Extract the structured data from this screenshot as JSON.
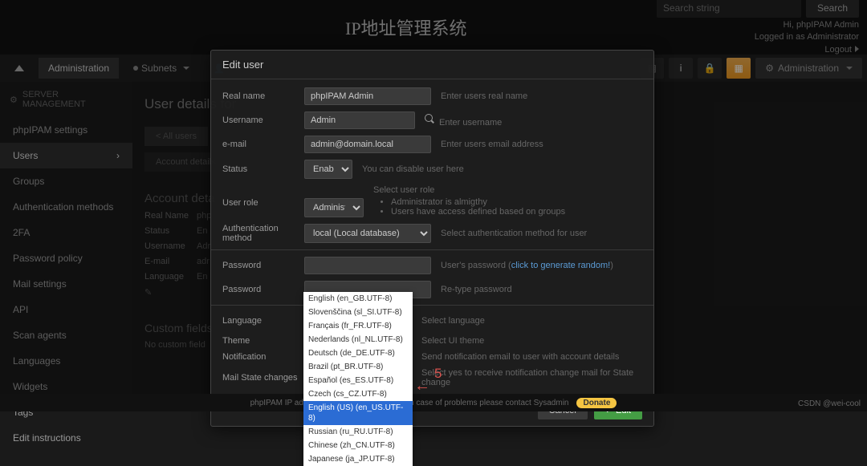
{
  "header": {
    "app_title": "IP地址管理系统",
    "search_placeholder": "Search string",
    "search_btn": "Search",
    "greeting": "Hi, phpIPAM Admin",
    "login_status": "Logged in as Administrator",
    "logout": "Logout"
  },
  "nav": {
    "administration": "Administration",
    "subnets": "Subnets",
    "admin_right": "Administration"
  },
  "sidebar": {
    "head": "SERVER MANAGEMENT",
    "items": [
      "phpIPAM settings",
      "Users",
      "Groups",
      "Authentication methods",
      "2FA",
      "Password policy",
      "Mail settings",
      "API",
      "Scan agents",
      "Languages",
      "Widgets",
      "Tags",
      "Edit instructions"
    ]
  },
  "page": {
    "title": "User details for",
    "back": "< All users",
    "tab": "Account details",
    "section": "Account deta",
    "rows": {
      "real_name_l": "Real Name",
      "real_name_v": "php",
      "status_l": "Status",
      "status_v": "En",
      "username_l": "Username",
      "username_v": "Adr",
      "email_l": "E-mail",
      "email_v": "adr",
      "language_l": "Language",
      "language_v": "En"
    },
    "custom_h": "Custom fields",
    "no_custom": "No custom field"
  },
  "modal": {
    "title": "Edit user",
    "labels": {
      "real_name": "Real name",
      "username": "Username",
      "email": "e-mail",
      "status": "Status",
      "user_role": "User role",
      "auth_method": "Authentication method",
      "password1": "Password",
      "password2": "Password",
      "language": "Language",
      "theme": "Theme",
      "notification": "Notification",
      "mail_state": "Mail State changes"
    },
    "values": {
      "real_name": "phpIPAM Admin",
      "username": "Admin",
      "email": "admin@domain.local",
      "status": "Enabled",
      "role": "Administrator",
      "auth": "local (Local database)",
      "language_selected": "English (US) (en_US.UTF-8)"
    },
    "hints": {
      "real_name": "Enter users real name",
      "username": "Enter username",
      "email": "Enter users email address",
      "status": "You can disable user here",
      "role_head": "Select user role",
      "role_1": "Administrator is almigthy",
      "role_2": "Users have access defined based on groups",
      "auth": "Select authentication method for user",
      "pass1_pre": "User's password (",
      "pass1_link": "click to generate random!",
      "pass1_post": ")",
      "pass2": "Re-type password",
      "language": "Select language",
      "theme": "Select UI theme",
      "notification": "Send notification email to user with account details",
      "mail_state": "Select yes to receive notification change mail for State change"
    },
    "buttons": {
      "cancel": "Cancel",
      "edit": "Edit"
    }
  },
  "lang_dd": {
    "options": [
      "English (en_GB.UTF-8)",
      "Slovenščina (sl_SI.UTF-8)",
      "Français (fr_FR.UTF-8)",
      "Nederlands (nl_NL.UTF-8)",
      "Deutsch (de_DE.UTF-8)",
      "Brazil (pt_BR.UTF-8)",
      "Español (es_ES.UTF-8)",
      "Czech (cs_CZ.UTF-8)",
      "English (US) (en_US.UTF-8)",
      "Russian (ru_RU.UTF-8)",
      "Chinese (zh_CN.UTF-8)",
      "Japanese (ja_JP.UTF-8)"
    ]
  },
  "annotation": {
    "number": "5"
  },
  "footer": {
    "text": "phpIPAM IP address management [v1.4.7]   |   In case of problems please contact Sysadmin",
    "donate": "Donate"
  },
  "watermark": "CSDN @wei-cool"
}
